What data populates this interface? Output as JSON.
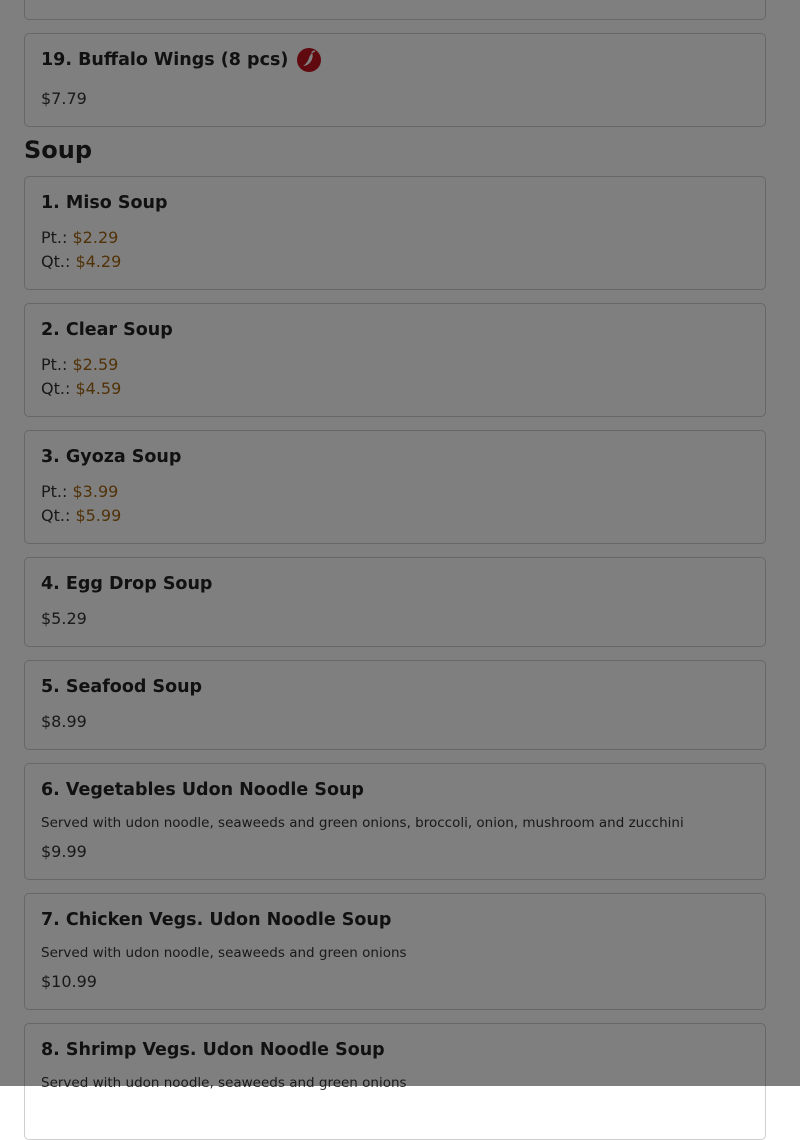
{
  "appetizer_item": {
    "name": "19. Buffalo Wings (8 pcs)",
    "price": "$7.79",
    "icon": "spicy-pepper-icon"
  },
  "section": {
    "title": "Soup"
  },
  "soups": [
    {
      "name": "1. Miso Soup",
      "sizes": [
        {
          "label": "Pt.:",
          "price": "$2.29"
        },
        {
          "label": "Qt.:",
          "price": "$4.29"
        }
      ]
    },
    {
      "name": "2. Clear Soup",
      "sizes": [
        {
          "label": "Pt.:",
          "price": "$2.59"
        },
        {
          "label": "Qt.:",
          "price": "$4.59"
        }
      ]
    },
    {
      "name": "3. Gyoza Soup",
      "sizes": [
        {
          "label": "Pt.:",
          "price": "$3.99"
        },
        {
          "label": "Qt.:",
          "price": "$5.99"
        }
      ]
    },
    {
      "name": "4. Egg Drop Soup",
      "price": "$5.29"
    },
    {
      "name": "5. Seafood Soup",
      "price": "$8.99"
    },
    {
      "name": "6. Vegetables Udon Noodle Soup",
      "description": "Served with udon noodle, seaweeds and green onions, broccoli, onion, mushroom and zucchini",
      "price": "$9.99"
    },
    {
      "name": "7. Chicken Vegs. Udon Noodle Soup",
      "description": "Served with udon noodle, seaweeds and green onions",
      "price": "$10.99"
    },
    {
      "name": "8. Shrimp Vegs. Udon Noodle Soup",
      "description": "Served with udon noodle, seaweeds and green onions"
    }
  ],
  "colors": {
    "price": "#a26510",
    "spicy_icon": "#c1121f",
    "overlay": "rgba(0,0,0,0.5)"
  }
}
